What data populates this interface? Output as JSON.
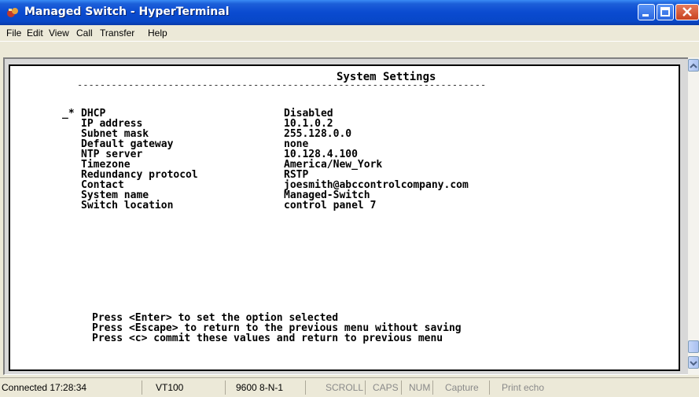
{
  "window": {
    "title": "Managed Switch - HyperTerminal"
  },
  "menu": [
    "File",
    "Edit",
    "View",
    "Call",
    "Transfer",
    "Help"
  ],
  "screen": {
    "heading": "System Settings",
    "divider": "------------------------------------------------------------------------",
    "cursor": "_*",
    "settings": [
      {
        "name": "DHCP",
        "value": "Disabled"
      },
      {
        "name": "IP address",
        "value": "10.1.0.2"
      },
      {
        "name": "Subnet mask",
        "value": "255.128.0.0"
      },
      {
        "name": "Default gateway",
        "value": "none"
      },
      {
        "name": "NTP server",
        "value": "10.128.4.100"
      },
      {
        "name": "Timezone",
        "value": "America/New_York"
      },
      {
        "name": "Redundancy protocol",
        "value": "RSTP"
      },
      {
        "name": "Contact",
        "value": "joesmith@abccontrolcompany.com"
      },
      {
        "name": "System name",
        "value": "Managed-Switch"
      },
      {
        "name": "Switch location",
        "value": "control panel 7"
      }
    ],
    "help": [
      "Press <Enter> to set the option selected",
      "Press <Escape> to return to the previous menu without saving",
      "Press <c> commit these values and return to previous menu"
    ]
  },
  "status": {
    "connection": "Connected 17:28:34",
    "emulation": "VT100",
    "port": "9600 8-N-1",
    "scroll": "SCROLL",
    "caps": "CAPS",
    "num": "NUM",
    "capture": "Capture",
    "print_echo": "Print echo"
  }
}
